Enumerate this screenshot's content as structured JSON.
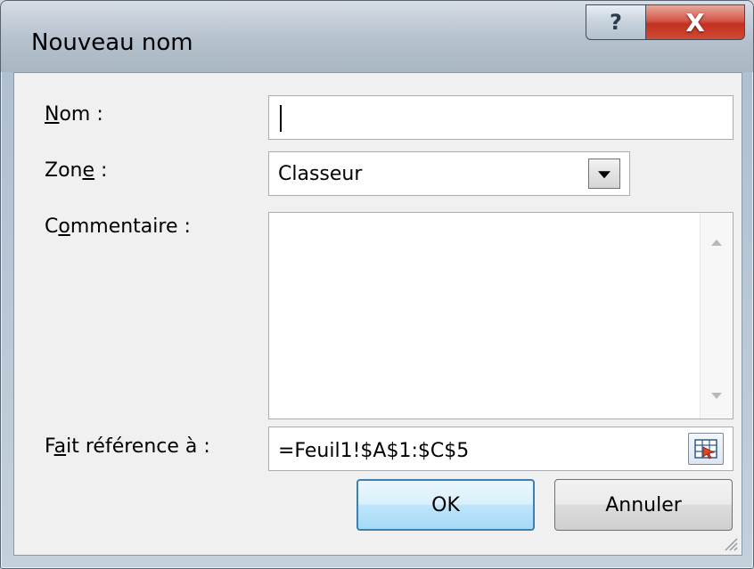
{
  "window": {
    "title": "Nouveau nom",
    "help_label": "?",
    "close_label": "X"
  },
  "form": {
    "name": {
      "label_prefix": "",
      "label_mnemonic": "N",
      "label_suffix": "om :",
      "value": ""
    },
    "scope": {
      "label_prefix": "Zon",
      "label_mnemonic": "e",
      "label_suffix": " :",
      "value": "Classeur"
    },
    "comment": {
      "label_prefix": "C",
      "label_mnemonic": "o",
      "label_suffix": "mmentaire :",
      "value": ""
    },
    "refers_to": {
      "label_prefix": "F",
      "label_mnemonic": "a",
      "label_suffix": "it référence à :",
      "value": "=Feuil1!$A$1:$C$5"
    }
  },
  "buttons": {
    "ok": "OK",
    "cancel": "Annuler"
  },
  "icons": {
    "help": "help-icon",
    "close": "close-icon",
    "dropdown": "chevron-down-icon",
    "collapse": "collapse-dialog-icon",
    "grip": "resize-grip-icon"
  }
}
